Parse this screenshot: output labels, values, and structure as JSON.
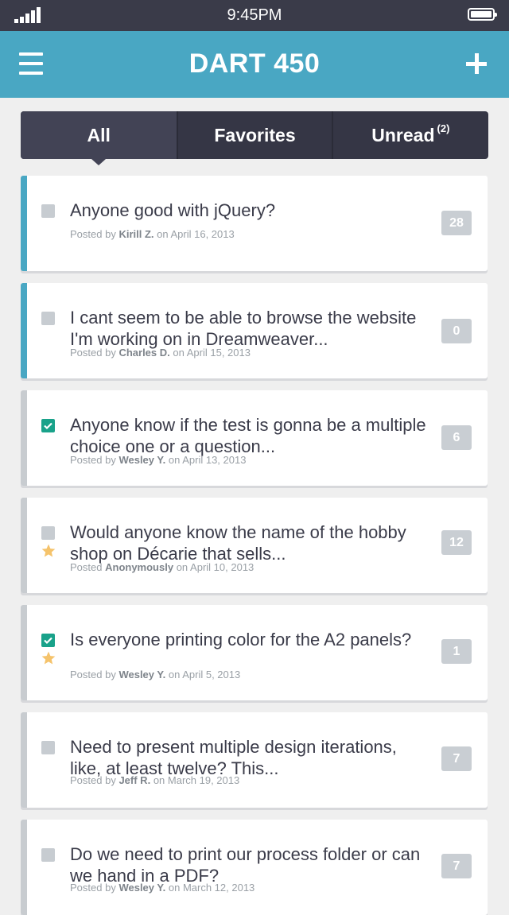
{
  "status_bar": {
    "time": "9:45PM"
  },
  "header": {
    "title": "DART 450"
  },
  "tabs": [
    {
      "label": "All",
      "badge": ""
    },
    {
      "label": "Favorites",
      "badge": ""
    },
    {
      "label": "Unread",
      "badge": "(2)"
    }
  ],
  "posts": [
    {
      "title": "Anyone good with jQuery?",
      "prefix": "Posted by",
      "author": "Kirill Z.",
      "date_text": "on April 16, 2013",
      "count": "28",
      "checked": false,
      "favorite": false,
      "unread": true
    },
    {
      "title": "I cant seem to be able to browse the website I'm working on in Dreamweaver...",
      "prefix": "Posted by",
      "author": "Charles D.",
      "date_text": "on April 15, 2013",
      "count": "0",
      "checked": false,
      "favorite": false,
      "unread": true
    },
    {
      "title": "Anyone know if the test is gonna be a multiple choice one or a question...",
      "prefix": "Posted by",
      "author": "Wesley Y.",
      "date_text": "on April 13, 2013",
      "count": "6",
      "checked": true,
      "favorite": false,
      "unread": false
    },
    {
      "title": "Would anyone know the name of the hobby shop on Décarie  that sells...",
      "prefix": "Posted",
      "author": "Anonymously",
      "date_text": "on April 10, 2013",
      "count": "12",
      "checked": false,
      "favorite": true,
      "unread": false
    },
    {
      "title": "Is everyone printing color for the A2 panels?",
      "prefix": "Posted by",
      "author": "Wesley Y.",
      "date_text": "on April 5, 2013",
      "count": "1",
      "checked": true,
      "favorite": true,
      "unread": false
    },
    {
      "title": "Need to present multiple design iterations, like, at least twelve? This...",
      "prefix": "Posted by",
      "author": "Jeff R.",
      "date_text": "on March 19, 2013",
      "count": "7",
      "checked": false,
      "favorite": false,
      "unread": false
    },
    {
      "title": "Do we need to print our process folder or can we hand in a PDF?",
      "prefix": "Posted by",
      "author": "Wesley Y.",
      "date_text": "on March 12, 2013",
      "count": "7",
      "checked": false,
      "favorite": false,
      "unread": false
    }
  ],
  "icons": {
    "signal": "signal-icon",
    "battery": "battery-icon",
    "menu": "menu-icon",
    "add": "add-icon",
    "star": "star-icon",
    "checkbox": "checkbox-icon"
  },
  "colors": {
    "accent": "#49a7c3",
    "dark": "#353645",
    "check": "#19a28a",
    "star": "#f5c36b"
  }
}
